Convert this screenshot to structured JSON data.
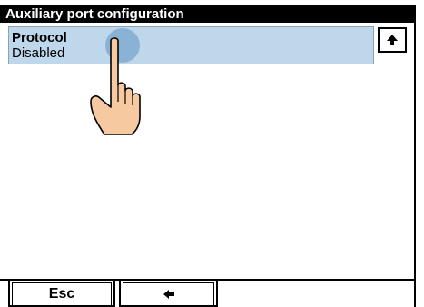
{
  "window": {
    "title": "Auxiliary port configuration"
  },
  "settings": {
    "items": [
      {
        "label": "Protocol",
        "value": "Disabled"
      }
    ]
  },
  "footer": {
    "esc_label": "Esc",
    "back_icon": "arrow-left-icon"
  },
  "icons": {
    "scroll_up": "arrow-up-icon",
    "touch": "hand-pointer-icon"
  },
  "colors": {
    "title_bar": "#000000",
    "selected_row": "#bfd7ea",
    "touch_highlight": "#78a5cd",
    "hand_fill": "#f6c9a0"
  }
}
